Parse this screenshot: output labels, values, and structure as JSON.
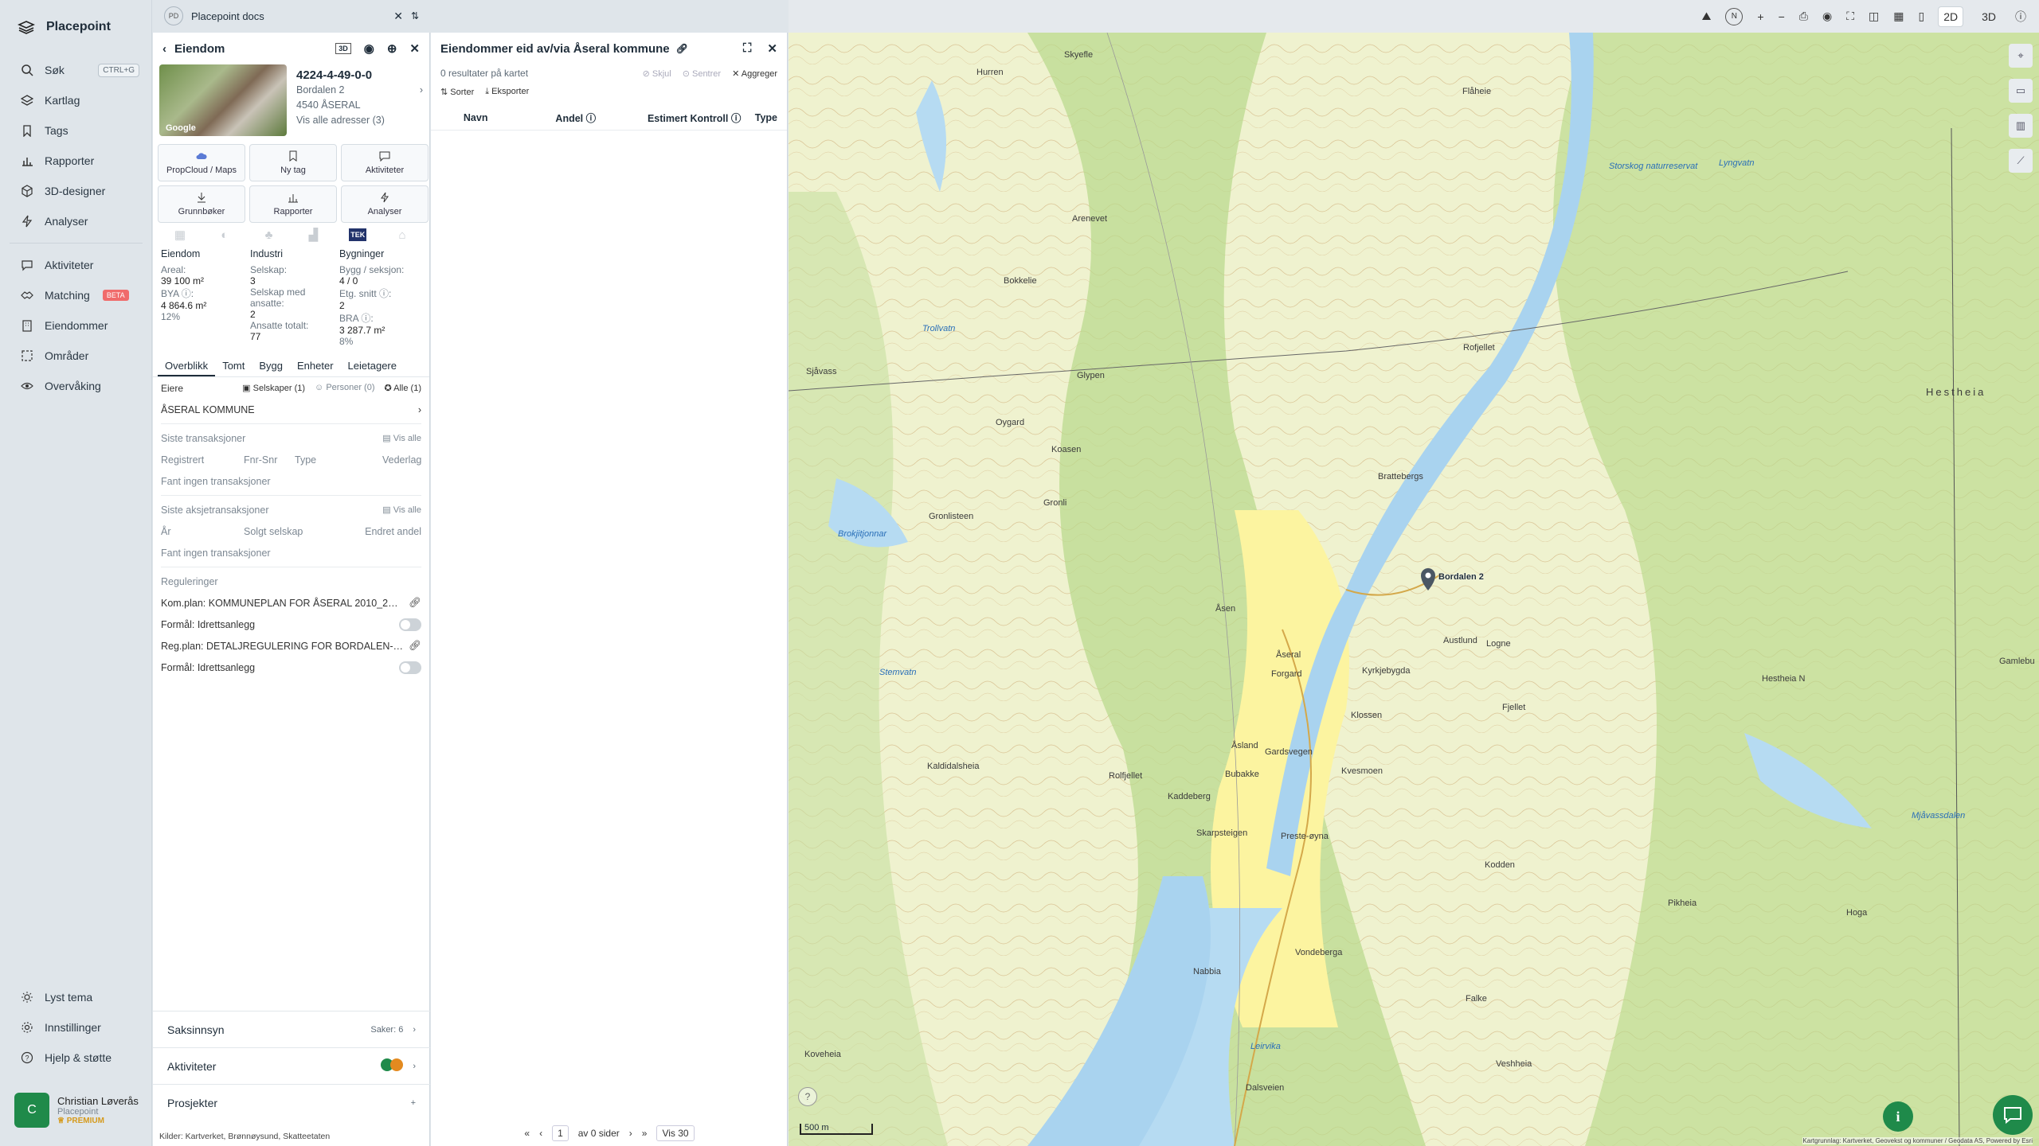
{
  "brand": "Placepoint",
  "nav": {
    "items": [
      {
        "label": "Søk",
        "kbd": "CTRL+G"
      },
      {
        "label": "Kartlag"
      },
      {
        "label": "Tags"
      },
      {
        "label": "Rapporter"
      },
      {
        "label": "3D-designer"
      },
      {
        "label": "Analyser"
      }
    ],
    "items2": [
      {
        "label": "Aktiviteter"
      },
      {
        "label": "Matching",
        "badge": "BETA"
      },
      {
        "label": "Eiendommer"
      },
      {
        "label": "Områder"
      },
      {
        "label": "Overvåking"
      }
    ],
    "bottom": [
      {
        "label": "Lyst tema"
      },
      {
        "label": "Innstillinger"
      },
      {
        "label": "Hjelp & støtte"
      }
    ]
  },
  "user": {
    "initial": "C",
    "name": "Christian Løverås",
    "org": "Placepoint",
    "plan": "PREMIUM"
  },
  "tab": {
    "badge": "PD",
    "title": "Placepoint docs"
  },
  "property": {
    "header": "Eiendom",
    "id": "4224-4-49-0-0",
    "address": "Bordalen 2",
    "postal": "4540 ÅSERAL",
    "all_addresses": "Vis alle adresser (3)",
    "photo_credit": "Google",
    "buttons": [
      "PropCloud / Maps",
      "Ny tag",
      "Aktiviteter",
      "Grunnbøker",
      "Rapporter",
      "Analyser"
    ],
    "stats": {
      "eiendom": {
        "h": "Eiendom",
        "areal_l": "Areal:",
        "areal_v": "39 100 m²",
        "bya_l": "BYA ⓘ:",
        "bya_v": "4 864.6 m²",
        "bya_p": "12%"
      },
      "industri": {
        "h": "Industri",
        "selskap_l": "Selskap:",
        "selskap_v": "3",
        "ansatte_l": "Selskap med ansatte:",
        "ansatte_v": "2",
        "tot_l": "Ansatte totalt:",
        "tot_v": "77"
      },
      "bygninger": {
        "h": "Bygninger",
        "bygg_l": "Bygg / seksjon:",
        "bygg_v": "4 / 0",
        "etg_l": "Etg. snitt ⓘ:",
        "etg_v": "2",
        "bra_l": "BRA ⓘ:",
        "bra_v": "3 287.7 m²",
        "bra_p": "8%"
      }
    },
    "tabs": [
      "Overblikk",
      "Tomt",
      "Bygg",
      "Enheter",
      "Leietagere"
    ],
    "owners": {
      "label": "Eiere",
      "f1": "Selskaper (1)",
      "f2": "Personer (0)",
      "f3": "Alle (1)",
      "owner": "ÅSERAL KOMMUNE"
    },
    "transactions": {
      "title": "Siste transaksjoner",
      "link": "Vis alle",
      "cols": [
        "Registrert",
        "Fnr-Snr",
        "Type",
        "Vederlag"
      ],
      "empty": "Fant ingen transaksjoner"
    },
    "shares": {
      "title": "Siste aksjetransaksjoner",
      "link": "Vis alle",
      "cols": [
        "År",
        "Solgt selskap",
        "Endret andel"
      ],
      "empty": "Fant ingen transaksjoner"
    },
    "regulations": {
      "title": "Reguleringer",
      "r1": "Kom.plan: KOMMUNEPLAN FOR ÅSERAL 2010_2…",
      "f1": "Formål: Idrettsanlegg",
      "r2": "Reg.plan: DETALJREGULERING FOR BORDALEN-…",
      "f2": "Formål: Idrettsanlegg"
    },
    "bottom": {
      "saks": "Saksinnsyn",
      "saker": "Saker: 6",
      "akt": "Aktiviteter",
      "prosj": "Prosjekter"
    },
    "sources": "Kilder:  Kartverket,  Brønnøysund,  Skatteetaten"
  },
  "owned": {
    "title": "Eiendommer eid av/via Åseral kommune",
    "count": "0 resultater på kartet",
    "actions": [
      "Skjul",
      "Sentrer",
      "Aggreger"
    ],
    "tools": [
      "Sorter",
      "Eksporter"
    ],
    "cols": [
      "Navn",
      "Andel ⓘ",
      "Estimert Kontroll ⓘ",
      "Type"
    ],
    "pager": {
      "page": "1",
      "of": "av 0 sider",
      "size": "Vis 30"
    }
  },
  "map": {
    "modes": [
      "2D",
      "3D"
    ],
    "north": "N",
    "scale": "500 m",
    "attribution": "Kartgrunnlag: Kartverket, Geovekst og kommuner / Geodata AS, Powered by Esri",
    "labels": {
      "marker": "Bordalen 2",
      "l1": "Skyefle",
      "l2": "Hurren",
      "l3": "Flåheie",
      "l4": "Lyngvatn",
      "l5": "Bokkelie",
      "l6": "Arenevet",
      "l7": "Rofjellet",
      "l8": "Glypen",
      "l9": "Sjåvass",
      "l10": "Oygard",
      "l11": "Koasen",
      "l12": "Gronli",
      "l13": "Gronlisteen",
      "l14": "Brattebergs",
      "l15": "Brokjitjonnar",
      "l16": "Åsen",
      "l17": "Åseral",
      "l18": "Forgard",
      "l19": "Kyrkjebygda",
      "l20": "Klossen",
      "l21": "Kvesmoen",
      "l22": "Åsland",
      "l23": "Bubakke",
      "l24": "Kaddeberg",
      "l25": "Skarpsteigen",
      "l26": "Preste-øyna",
      "l27": "Nabbia",
      "l28": "Vondeberga",
      "l29": "Hestheia",
      "l30": "Gamlebu",
      "l31": "Kaldidalsheia",
      "l32": "Rolfjellet",
      "l33": "Hoga",
      "l34": "Pikheia",
      "l35": "Leirvika",
      "l36": "Veshheia",
      "l37": "Falke",
      "l38": "Koveheia",
      "l39": "Stemvatn",
      "l40": "Mjåvassdalen",
      "l41": "Trollvatn",
      "l42": "Austlund",
      "l43": "Logne",
      "l44": "Fjellet",
      "l45": "Storskog naturreservat",
      "l46": "Dalsveien",
      "l47": "Gardsvegen",
      "l48": "Kodden",
      "l49": "Hestheia N"
    }
  }
}
